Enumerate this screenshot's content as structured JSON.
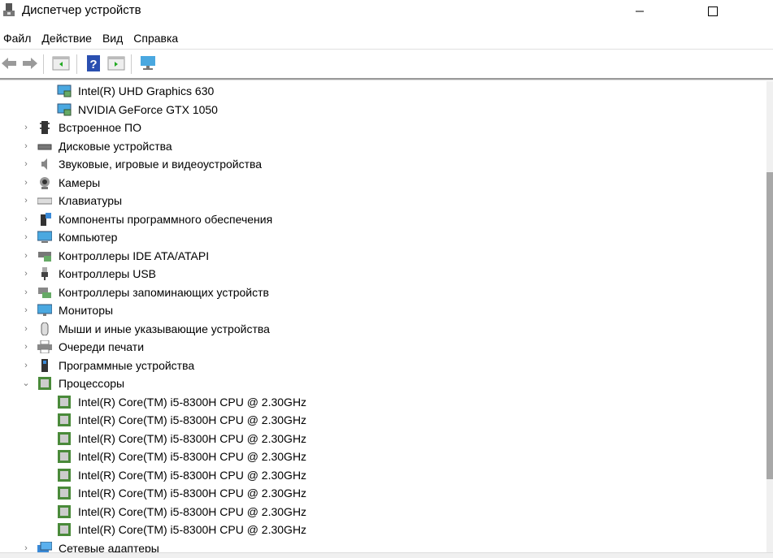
{
  "window": {
    "title": "Диспетчер устройств"
  },
  "menu": [
    "Файл",
    "Действие",
    "Вид",
    "Справка"
  ],
  "toolbar": [
    "back-icon",
    "forward-icon",
    "properties-icon",
    "help-icon",
    "update-driver-icon",
    "scan-hardware-icon"
  ],
  "tree": [
    {
      "level": 1,
      "label": "Intel(R) UHD Graphics 630",
      "icon": "display-adapter"
    },
    {
      "level": 1,
      "label": "NVIDIA GeForce GTX 1050",
      "icon": "display-adapter"
    },
    {
      "level": 0,
      "label": "Встроенное ПО",
      "icon": "firmware",
      "expanded": false
    },
    {
      "level": 0,
      "label": "Дисковые устройства",
      "icon": "disk",
      "expanded": false
    },
    {
      "level": 0,
      "label": "Звуковые, игровые и видеоустройства",
      "icon": "sound",
      "expanded": false
    },
    {
      "level": 0,
      "label": "Камеры",
      "icon": "camera",
      "expanded": false
    },
    {
      "level": 0,
      "label": "Клавиатуры",
      "icon": "keyboard",
      "expanded": false
    },
    {
      "level": 0,
      "label": "Компоненты программного обеспечения",
      "icon": "software-component",
      "expanded": false
    },
    {
      "level": 0,
      "label": "Компьютер",
      "icon": "computer",
      "expanded": false
    },
    {
      "level": 0,
      "label": "Контроллеры IDE ATA/ATAPI",
      "icon": "ide",
      "expanded": false
    },
    {
      "level": 0,
      "label": "Контроллеры USB",
      "icon": "usb",
      "expanded": false
    },
    {
      "level": 0,
      "label": "Контроллеры запоминающих устройств",
      "icon": "storage",
      "expanded": false
    },
    {
      "level": 0,
      "label": "Мониторы",
      "icon": "monitor",
      "expanded": false
    },
    {
      "level": 0,
      "label": "Мыши и иные указывающие устройства",
      "icon": "mouse",
      "expanded": false
    },
    {
      "level": 0,
      "label": "Очереди печати",
      "icon": "printer",
      "expanded": false
    },
    {
      "level": 0,
      "label": "Программные устройства",
      "icon": "software-device",
      "expanded": false
    },
    {
      "level": 0,
      "label": "Процессоры",
      "icon": "cpu",
      "expanded": true
    },
    {
      "level": 1,
      "label": "Intel(R) Core(TM) i5-8300H CPU @ 2.30GHz",
      "icon": "cpu"
    },
    {
      "level": 1,
      "label": "Intel(R) Core(TM) i5-8300H CPU @ 2.30GHz",
      "icon": "cpu"
    },
    {
      "level": 1,
      "label": "Intel(R) Core(TM) i5-8300H CPU @ 2.30GHz",
      "icon": "cpu"
    },
    {
      "level": 1,
      "label": "Intel(R) Core(TM) i5-8300H CPU @ 2.30GHz",
      "icon": "cpu"
    },
    {
      "level": 1,
      "label": "Intel(R) Core(TM) i5-8300H CPU @ 2.30GHz",
      "icon": "cpu"
    },
    {
      "level": 1,
      "label": "Intel(R) Core(TM) i5-8300H CPU @ 2.30GHz",
      "icon": "cpu"
    },
    {
      "level": 1,
      "label": "Intel(R) Core(TM) i5-8300H CPU @ 2.30GHz",
      "icon": "cpu"
    },
    {
      "level": 1,
      "label": "Intel(R) Core(TM) i5-8300H CPU @ 2.30GHz",
      "icon": "cpu"
    },
    {
      "level": 0,
      "label": "Сетевые адаптеры",
      "icon": "network",
      "expanded": false
    }
  ]
}
